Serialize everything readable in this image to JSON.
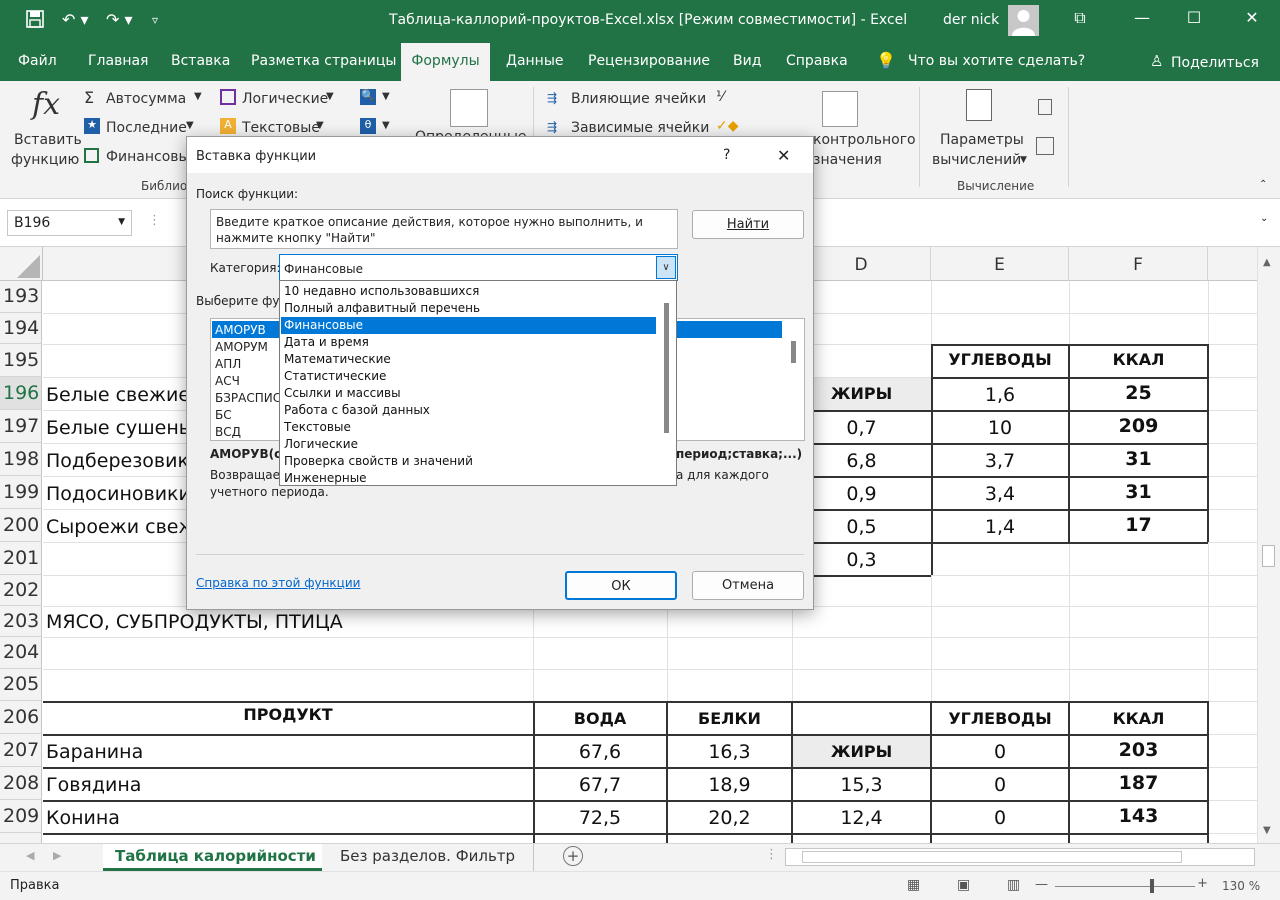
{
  "window": {
    "title": "Таблица-каллорий-проуктов-Excel.xlsx  [Режим совместимости]  -  Excel",
    "user": "der nick"
  },
  "menu": {
    "items": [
      "Файл",
      "Главная",
      "Вставка",
      "Разметка страницы",
      "Формулы",
      "Данные",
      "Рецензирование",
      "Вид",
      "Справка"
    ],
    "active": "Формулы",
    "tellme": "Что вы хотите сделать?",
    "share": "Поделиться"
  },
  "ribbon": {
    "insert_function_line1": "Вставить",
    "insert_function_line2": "функцию",
    "autosum": "Автосумма",
    "recent": "Последние",
    "financial": "Финансовы",
    "logical": "Логические",
    "text": "Текстовые",
    "group_library": "Библио",
    "defined_names": "Определенные",
    "trace_precedents": "Влияющие ячейки",
    "trace_dependents": "Зависимые ячейки",
    "watch_line1": "контрольного",
    "watch_line2": "значения",
    "calc_options_line1": "Параметры",
    "calc_options_line2": "вычислений",
    "group_calculation": "Вычисление"
  },
  "formula_bar": {
    "name_box": "B196"
  },
  "grid": {
    "columns": [
      "D",
      "E",
      "F"
    ],
    "rows": [
      {
        "num": "193"
      },
      {
        "num": "194"
      },
      {
        "num": "195",
        "e": "УГЛЕВОДЫ",
        "f": "ККАЛ"
      },
      {
        "num": "196",
        "a": "Белые свежие",
        "d": "ЖИРЫ",
        "e": "1,6",
        "f": "25"
      },
      {
        "num": "197",
        "a": "Белые сушеные",
        "d": "0,7",
        "e": "10",
        "f": "209"
      },
      {
        "num": "198",
        "a": "Подберезовики",
        "d": "6,8",
        "e": "3,7",
        "f": "31"
      },
      {
        "num": "199",
        "a": "Подосиновики с",
        "d": "0,9",
        "e": "3,4",
        "f": "31"
      },
      {
        "num": "200",
        "a": "Сыроежи свежи",
        "d": "0,5",
        "e": "1,4",
        "f": "17"
      },
      {
        "num": "201",
        "d": "0,3"
      },
      {
        "num": "202"
      },
      {
        "num": "203",
        "a": "МЯСО, СУБПРОДУКТЫ, ПТИЦА"
      },
      {
        "num": "204"
      },
      {
        "num": "205"
      },
      {
        "num": "206",
        "a": "ПРОДУКТ",
        "b": "ВОДА",
        "c": "БЕЛКИ",
        "e": "УГЛЕВОДЫ",
        "f": "ККАЛ"
      },
      {
        "num": "207",
        "a": "Баранина",
        "b": "67,6",
        "c": "16,3",
        "d": "ЖИРЫ",
        "e": "0",
        "f": "203"
      },
      {
        "num": "208",
        "a": "Говядина",
        "b": "67,7",
        "c": "18,9",
        "d": "15,3",
        "e": "0",
        "f": "187"
      },
      {
        "num": "209",
        "a": "Конина",
        "b": "72,5",
        "c": "20,2",
        "d": "12,4",
        "e": "0",
        "f": "143"
      }
    ]
  },
  "sheets": {
    "tab1": "Таблица калорийности",
    "tab2": "Без разделов. Фильтр"
  },
  "status": {
    "mode": "Правка",
    "zoom": "130 %"
  },
  "dialog": {
    "title": "Вставка функции",
    "help_q": "?",
    "search_label": "Поиск функции:",
    "search_text": "Введите краткое описание действия, которое нужно выполнить, и нажмите кнопку \"Найти\"",
    "find_button": "Найти",
    "category_label": "Категория:",
    "category_value": "Финансовые",
    "select_label": "Выберите функ",
    "functions": [
      "АМОРУВ",
      "АМОРУМ",
      "АПЛ",
      "АСЧ",
      "БЗРАСПИС",
      "БС",
      "ВСД"
    ],
    "signature_left": "АМОРУВ(ст",
    "signature_right": "период;ставка;...)",
    "desc_left": "Возвращает",
    "desc_right": "а для каждого",
    "desc_line2": "учетного периода.",
    "help_link": "Справка по этой функции",
    "ok": "ОК",
    "cancel": "Отмена",
    "categories": [
      "10 недавно использовавшихся",
      "Полный алфавитный перечень",
      "Финансовые",
      "Дата и время",
      "Математические",
      "Статистические",
      "Ссылки и массивы",
      "Работа с базой данных",
      "Текстовые",
      "Логические",
      "Проверка свойств и значений",
      "Инженерные"
    ]
  }
}
